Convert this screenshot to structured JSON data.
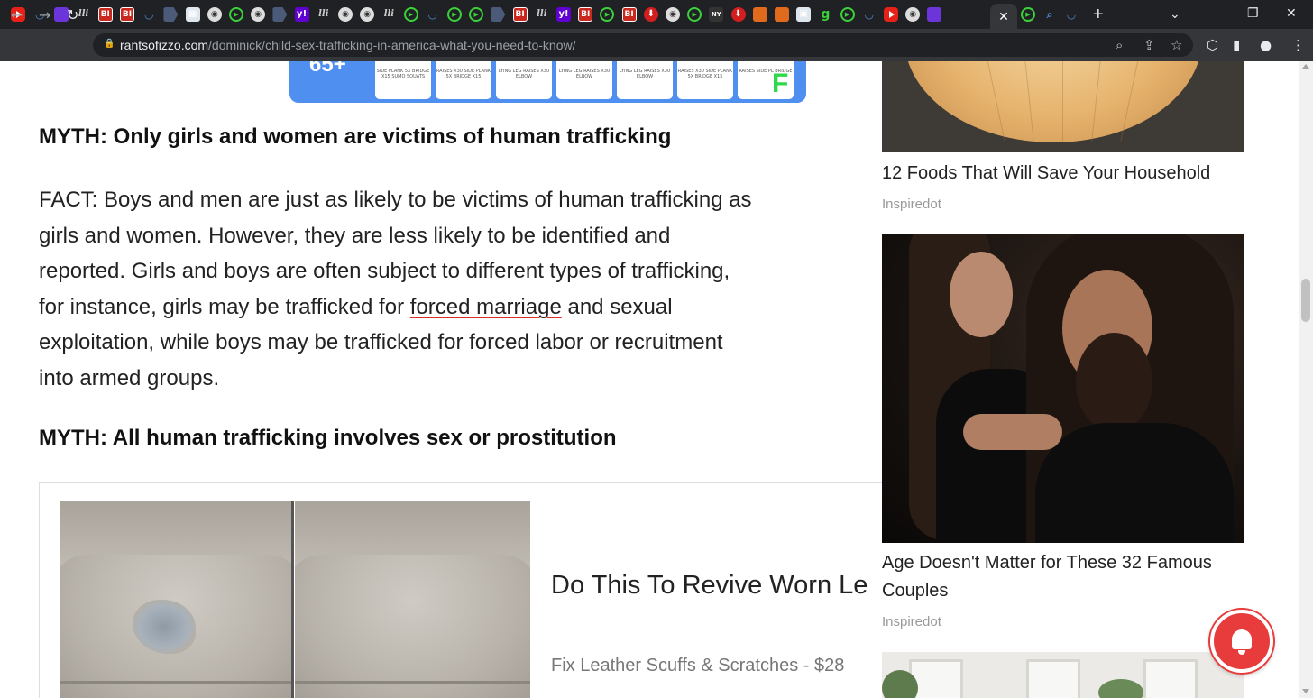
{
  "browser": {
    "tabs": [
      {
        "icon": "youtube-icon"
      },
      {
        "icon": "shield-icon"
      },
      {
        "icon": "yahoo-mail-icon"
      },
      {
        "icon": "ll-icon"
      },
      {
        "icon": "bi-icon",
        "label": "BI"
      },
      {
        "icon": "bi-icon",
        "label": "BI"
      },
      {
        "icon": "shield-icon"
      },
      {
        "icon": "arrow-icon"
      },
      {
        "icon": "picture-icon"
      },
      {
        "icon": "globe-icon"
      },
      {
        "icon": "play-icon"
      },
      {
        "icon": "globe-icon"
      },
      {
        "icon": "arrow-icon"
      },
      {
        "icon": "yahoo-icon",
        "label": "y!"
      },
      {
        "icon": "ll-icon"
      },
      {
        "icon": "globe-icon"
      },
      {
        "icon": "globe-icon"
      },
      {
        "icon": "ll-icon"
      },
      {
        "icon": "play-icon"
      },
      {
        "icon": "shield-icon"
      },
      {
        "icon": "play-icon"
      },
      {
        "icon": "play-icon"
      },
      {
        "icon": "arrow-icon"
      },
      {
        "icon": "bi-icon",
        "label": "BI"
      },
      {
        "icon": "ll-icon"
      },
      {
        "icon": "yahoo-icon",
        "label": "y!"
      },
      {
        "icon": "bi-icon",
        "label": "BI"
      },
      {
        "icon": "play-icon"
      },
      {
        "icon": "bi-icon",
        "label": "BI"
      },
      {
        "icon": "red-pin-icon"
      },
      {
        "icon": "globe-icon"
      },
      {
        "icon": "play-icon"
      },
      {
        "icon": "news-icon",
        "label": "NY"
      },
      {
        "icon": "red-pin-icon"
      },
      {
        "icon": "bookmark-icon"
      },
      {
        "icon": "bookmark-icon"
      },
      {
        "icon": "store-icon"
      },
      {
        "icon": "green-g-icon",
        "label": "g"
      },
      {
        "icon": "play-icon"
      },
      {
        "icon": "shield-icon"
      },
      {
        "icon": "youtube-icon"
      },
      {
        "icon": "globe-icon"
      },
      {
        "icon": "yahoo-mail-icon"
      }
    ],
    "active_tab": {
      "icon": "close-icon"
    },
    "trailing_tabs": [
      {
        "icon": "play-icon"
      },
      {
        "icon": "search-icon"
      },
      {
        "icon": "shield-icon"
      }
    ],
    "url_host": "rantsofizzo.com",
    "url_path": "/dominick/child-sex-trafficking-in-america-what-you-need-to-know/"
  },
  "article": {
    "infographic": {
      "age": "65+",
      "cards": [
        "SIDE PLANK 5X BRIDGE X15 SUMO SQUATS",
        "RAISES X30 SIDE PLANK 5X BRIDGE X15",
        "LYING LEG RAISES X30 ELBOW",
        "LYING LEG RAISES X30 ELBOW",
        "LYING LEG RAISES X30 ELBOW",
        "RAISES X30 SIDE PLANK 5X BRIDGE X15",
        "RAISES SIDE PL BRIDGE"
      ],
      "logo": "F"
    },
    "myth1": "MYTH: Only girls and women are victims of human trafficking",
    "fact": {
      "line1": "FACT: Boys and men are just as likely to be victims of human trafficking as",
      "line2": "girls and women. However, they are less likely to be identified and",
      "line3": "reported. Girls and boys are often subject to different types of trafficking,",
      "line4_pre": "for instance, girls may be trafficked for ",
      "link": "forced marriage",
      "line4_post": " and sexual",
      "line5": "exploitation, while boys may be trafficked for forced labor or recruitment",
      "line6": "into armed groups."
    },
    "myth2": "MYTH: All human trafficking involves sex or prostitution",
    "ad": {
      "title": "Do This To Revive Worn Le",
      "subtitle": "Fix Leather Scuffs & Scratches - $28"
    }
  },
  "sidebar": {
    "items": [
      {
        "title": "12 Foods That Will Save Your Household",
        "source": "Inspiredot"
      },
      {
        "title": "Age Doesn't Matter for These 32 Famous Couples",
        "source": "Inspiredot"
      }
    ]
  },
  "colors": {
    "chrome_bg": "#202124",
    "toolbar_bg": "#35363a",
    "link_underline": "#d93025",
    "notification_bell": "#e83b3b",
    "infographic_blue": "#4f8ff0"
  }
}
